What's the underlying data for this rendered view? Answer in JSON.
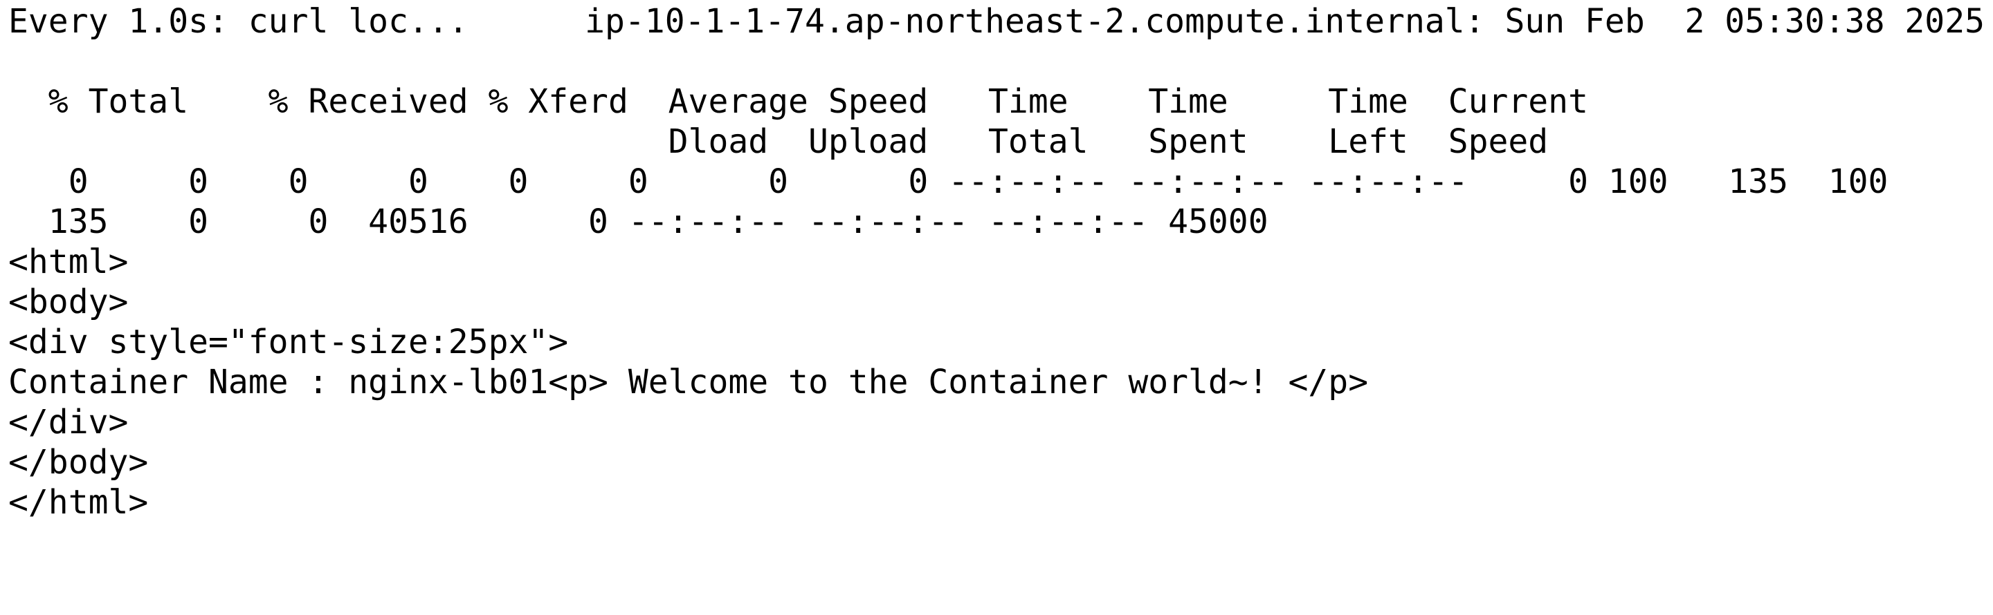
{
  "watch_header": {
    "left": "Every 1.0s: curl loc...",
    "right": "ip-10-1-1-74.ap-northeast-2.compute.internal: Sun Feb  2 05:30:38 2025"
  },
  "lines": [
    "",
    "  % Total    % Received % Xferd  Average Speed   Time    Time     Time  Current",
    "                                 Dload  Upload   Total   Spent    Left  Speed",
    "   0     0    0     0    0     0      0      0 --:--:-- --:--:-- --:--:--     0 100   135  100",
    "  135    0     0  40516      0 --:--:-- --:--:-- --:--:-- 45000",
    "<html>",
    "<body>",
    "<div style=\"font-size:25px\">",
    "Container Name : nginx-lb01<p> Welcome to the Container world~! </p>",
    "</div>",
    "</body>",
    "</html>"
  ]
}
